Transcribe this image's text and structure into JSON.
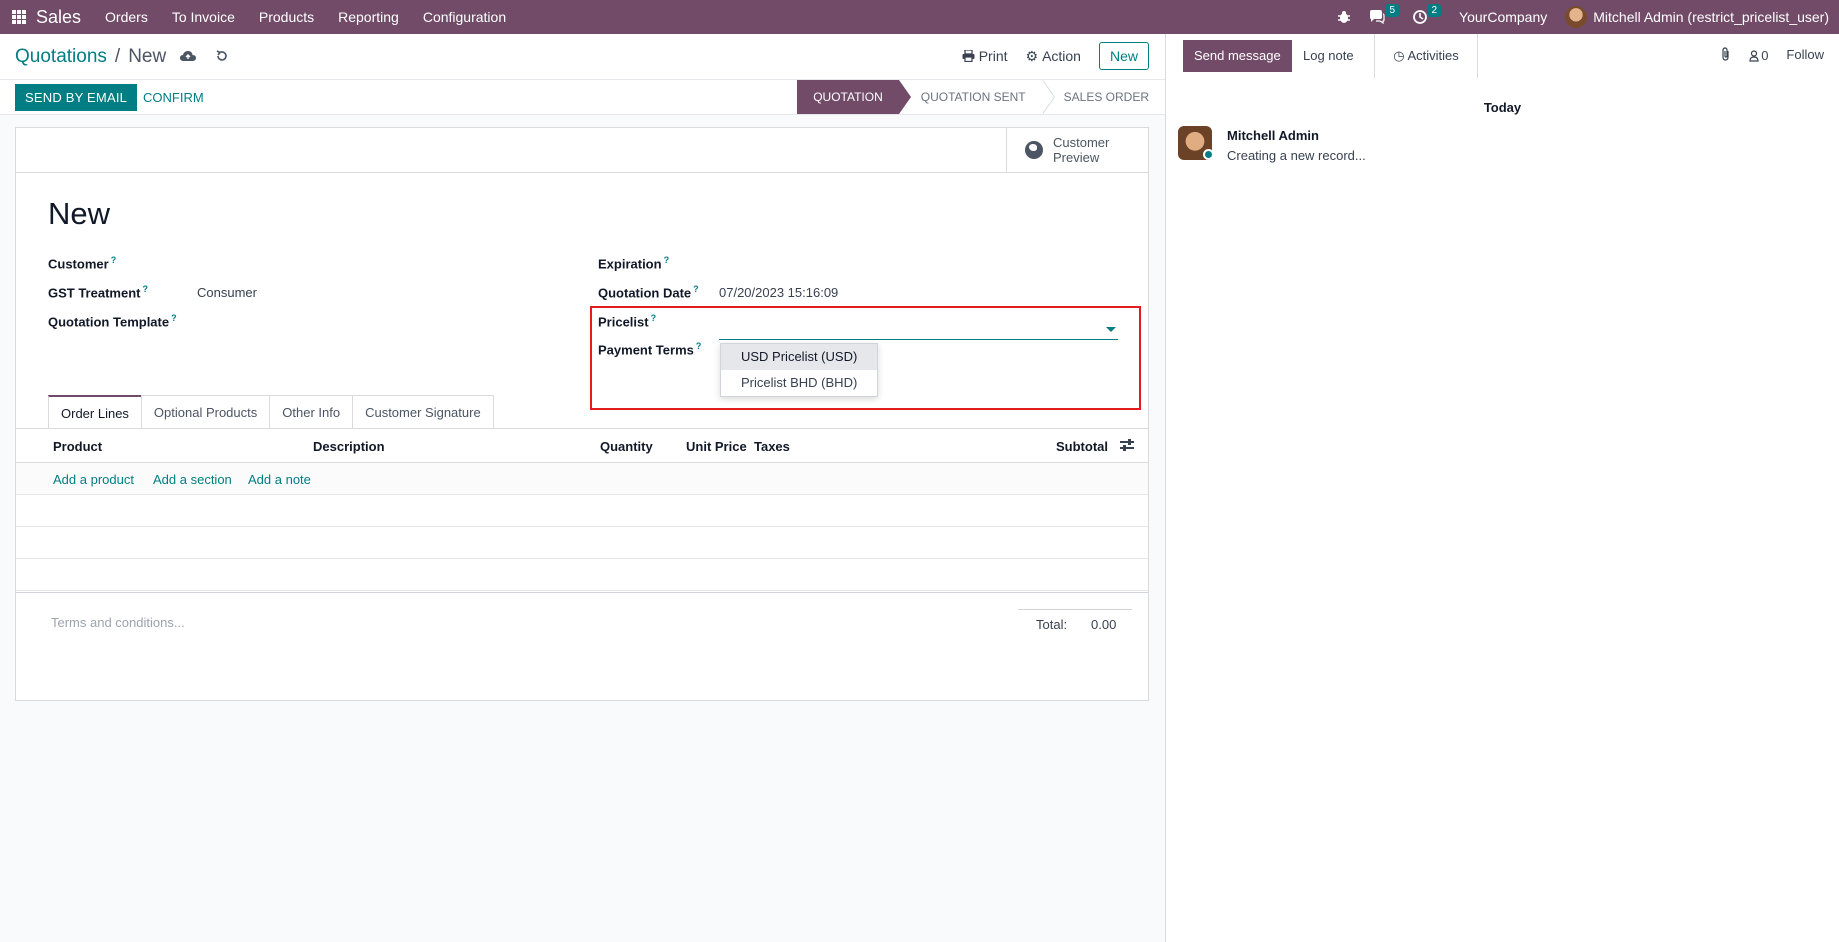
{
  "navbar": {
    "app_name": "Sales",
    "menu": [
      "Orders",
      "To Invoice",
      "Products",
      "Reporting",
      "Configuration"
    ],
    "messages_count": "5",
    "activities_count": "2",
    "company": "YourCompany",
    "user": "Mitchell Admin (restrict_pricelist_user)",
    "icons": [
      "apps-grid-icon",
      "bug-icon",
      "chat-icon",
      "clock-icon"
    ]
  },
  "control_panel": {
    "breadcrumb_parent": "Quotations",
    "breadcrumb_separator": "/",
    "breadcrumb_current": "New",
    "print_label": "Print",
    "action_label": "Action",
    "new_label": "New"
  },
  "statusbar": {
    "send_email_label": "SEND BY EMAIL",
    "confirm_label": "CONFIRM",
    "stages": [
      "QUOTATION",
      "QUOTATION SENT",
      "SALES ORDER"
    ],
    "active_stage": "QUOTATION"
  },
  "form": {
    "smart_button": "Customer\nPreview",
    "title": "New",
    "labels": {
      "customer": "Customer",
      "gst_treatment": "GST Treatment",
      "quotation_template": "Quotation Template",
      "expiration": "Expiration",
      "quotation_date": "Quotation Date",
      "pricelist": "Pricelist",
      "payment_terms": "Payment Terms"
    },
    "help_mark": "?",
    "values": {
      "gst_treatment": "Consumer",
      "quotation_date": "07/20/2023 15:16:09",
      "pricelist": ""
    },
    "pricelist_options": [
      "USD Pricelist (USD)",
      "Pricelist BHD (BHD)"
    ],
    "pricelist_highlighted": "USD Pricelist (USD)"
  },
  "tabs": [
    "Order Lines",
    "Optional Products",
    "Other Info",
    "Customer Signature"
  ],
  "order_lines": {
    "columns": [
      "Product",
      "Description",
      "Quantity",
      "Unit Price",
      "Taxes",
      "Subtotal"
    ],
    "add_links": [
      "Add a product",
      "Add a section",
      "Add a note"
    ]
  },
  "footer": {
    "terms_placeholder": "Terms and conditions...",
    "total_label": "Total:",
    "total_value": "0.00"
  },
  "chatter": {
    "send_message": "Send message",
    "log_note": "Log note",
    "activities": "Activities",
    "followers_count": "0",
    "follow": "Follow",
    "date_separator": "Today",
    "message": {
      "author": "Mitchell Admin",
      "body": "Creating a new record..."
    }
  },
  "colors": {
    "brand": "#714b67",
    "accent": "#017e84",
    "highlight_border": "#e11d1d"
  }
}
